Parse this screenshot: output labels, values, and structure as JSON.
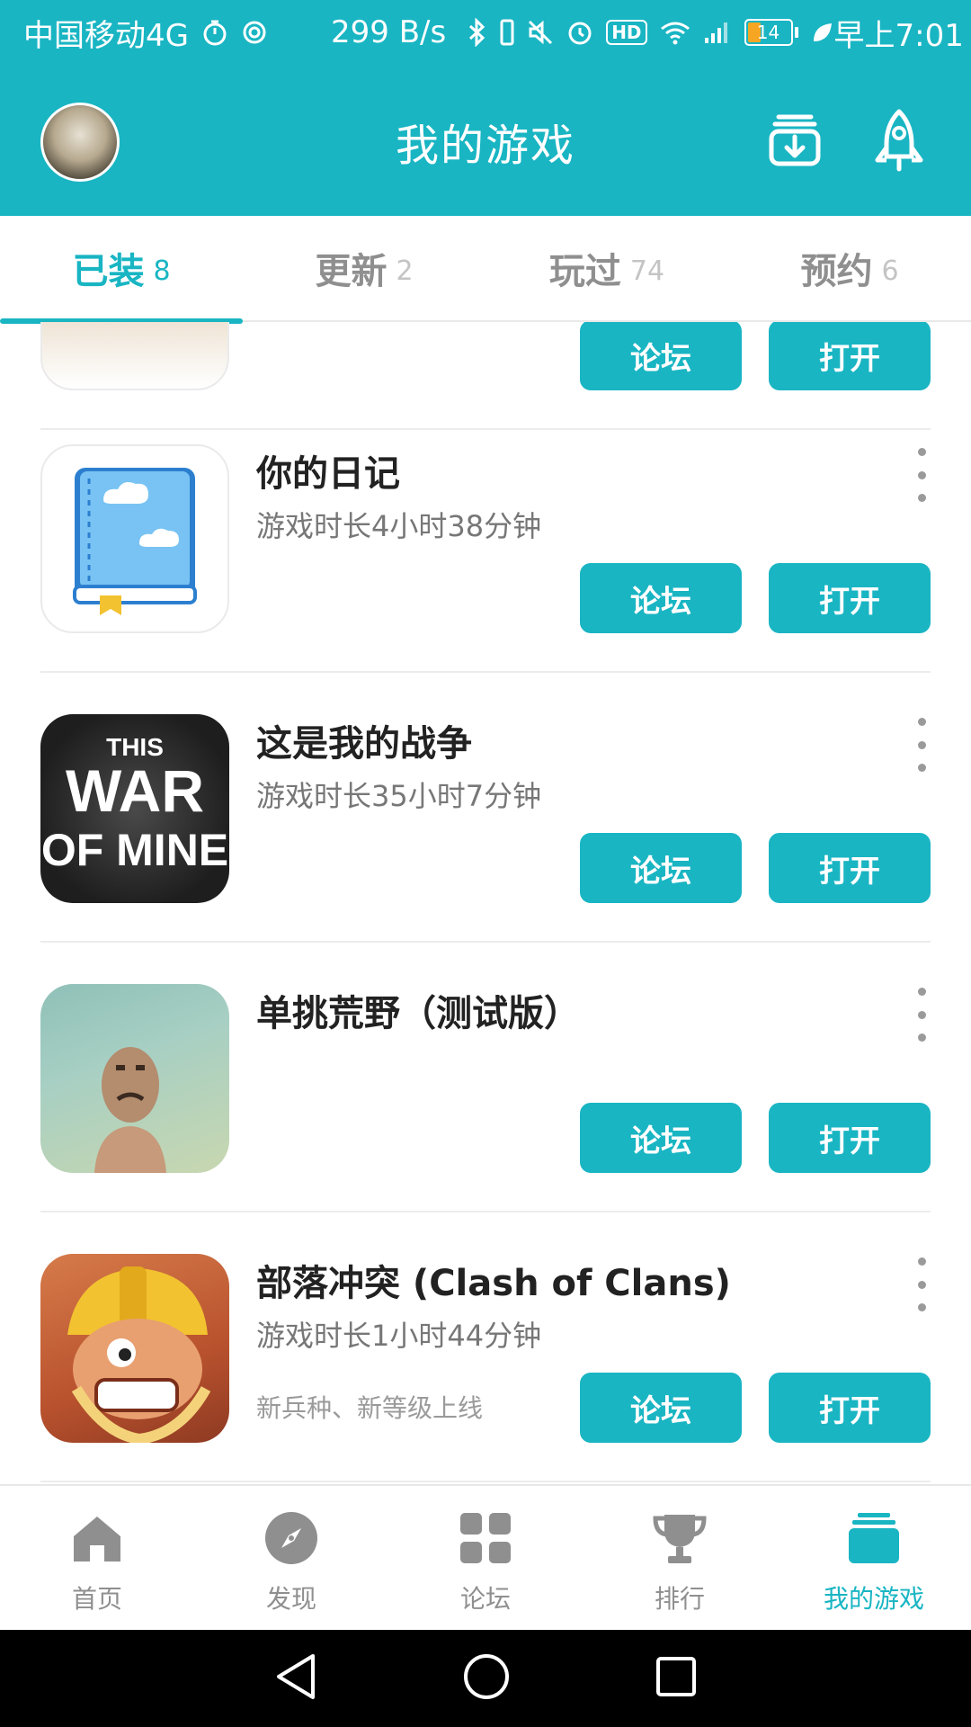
{
  "status_bar": {
    "carrier": "中国移动4G",
    "speed": "299 B/s",
    "hd": "HD",
    "battery": "14",
    "time": "早上7:01"
  },
  "header": {
    "title": "我的游戏"
  },
  "tabs": [
    {
      "label": "已装",
      "count": "8",
      "active": true
    },
    {
      "label": "更新",
      "count": "2",
      "active": false
    },
    {
      "label": "玩过",
      "count": "74",
      "active": false
    },
    {
      "label": "预约",
      "count": "6",
      "active": false
    }
  ],
  "buttons": {
    "forum": "论坛",
    "open": "打开"
  },
  "games": [
    {
      "name": "",
      "playtime": "",
      "note": ""
    },
    {
      "name": "你的日记",
      "playtime": "游戏时长4小时38分钟",
      "note": ""
    },
    {
      "name": "这是我的战争",
      "playtime": "游戏时长35小时7分钟",
      "note": "",
      "icon_text_top": "THIS",
      "icon_text_mid": "WAR",
      "icon_text_bottom": "OF MINE"
    },
    {
      "name": "单挑荒野（测试版）",
      "playtime": "",
      "note": ""
    },
    {
      "name": "部落冲突 (Clash of Clans)",
      "playtime": "游戏时长1小时44分钟",
      "note": "新兵种、新等级上线"
    }
  ],
  "bottom_nav": [
    {
      "label": "首页",
      "icon": "home-icon",
      "active": false
    },
    {
      "label": "发现",
      "icon": "compass-icon",
      "active": false
    },
    {
      "label": "论坛",
      "icon": "grid-icon",
      "active": false
    },
    {
      "label": "排行",
      "icon": "trophy-icon",
      "active": false
    },
    {
      "label": "我的游戏",
      "icon": "stack-icon",
      "active": true
    }
  ],
  "colors": {
    "accent": "#19b5c3",
    "inactive": "#8f8f8f"
  }
}
